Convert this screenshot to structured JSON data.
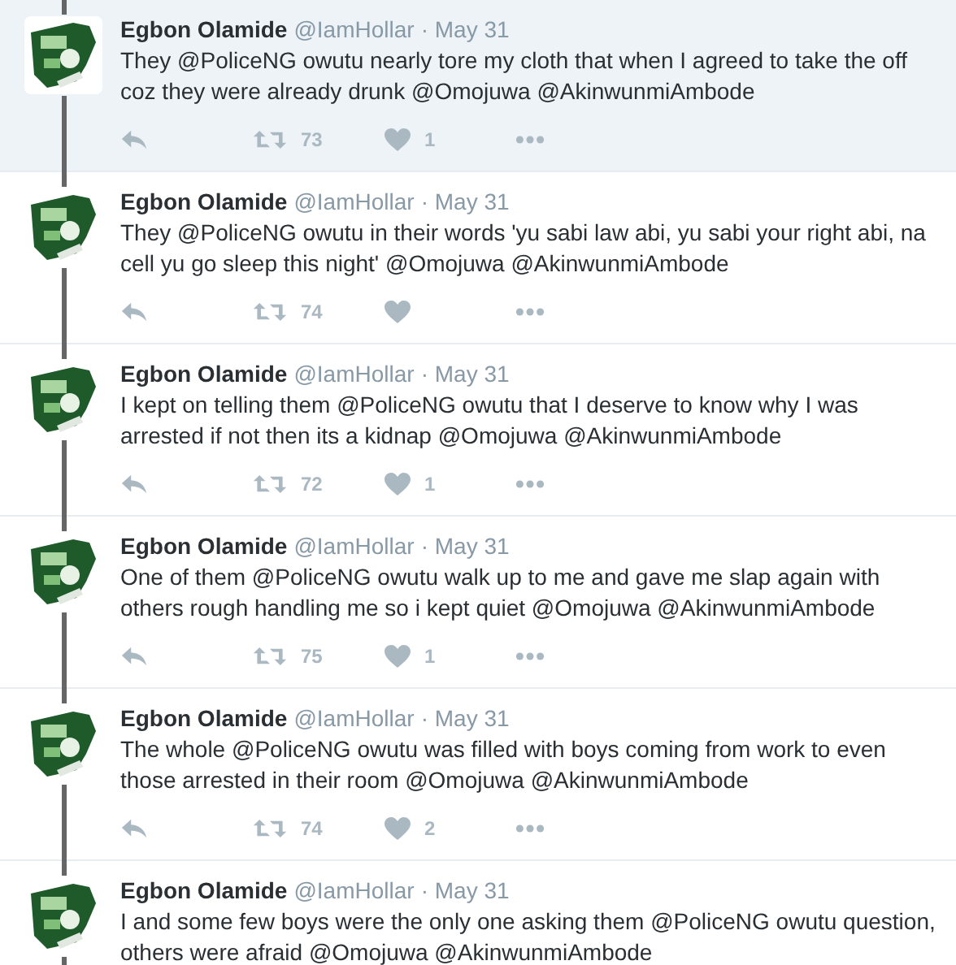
{
  "tweets": [
    {
      "name": "Egbon Olamide",
      "handle": "@IamHollar",
      "date": "· May 31",
      "text": "They @PoliceNG owutu nearly tore my cloth that when I agreed to take the off coz they were already drunk @Omojuwa @AkinwunmiAmbode",
      "retweets": "73",
      "likes": "1",
      "highlighted": true
    },
    {
      "name": "Egbon Olamide",
      "handle": "@IamHollar",
      "date": "· May 31",
      "text": "They @PoliceNG owutu in their words 'yu sabi law abi, yu sabi your right abi, na cell yu go sleep this night' @Omojuwa @AkinwunmiAmbode",
      "retweets": "74",
      "highlighted": false
    },
    {
      "name": "Egbon Olamide",
      "handle": "@IamHollar",
      "date": "· May 31",
      "text": "I kept on telling them @PoliceNG owutu that I deserve to know why I was arrested if not then its a kidnap @Omojuwa @AkinwunmiAmbode",
      "retweets": "72",
      "likes": "1",
      "highlighted": false
    },
    {
      "name": "Egbon Olamide",
      "handle": "@IamHollar",
      "date": "· May 31",
      "text": "One of them @PoliceNG owutu walk up to me and gave me slap again with others rough handling me so i kept quiet @Omojuwa @AkinwunmiAmbode",
      "retweets": "75",
      "likes": "1",
      "highlighted": false
    },
    {
      "name": "Egbon Olamide",
      "handle": "@IamHollar",
      "date": "· May 31",
      "text": "The whole @PoliceNG owutu was filled with boys coming from work to even those arrested in their room @Omojuwa @AkinwunmiAmbode",
      "retweets": "74",
      "likes": "2",
      "highlighted": false
    },
    {
      "name": "Egbon Olamide",
      "handle": "@IamHollar",
      "date": "· May 31",
      "text": "I and some few boys were the only one asking them @PoliceNG owutu question, others were afraid @Omojuwa @AkinwunmiAmbode",
      "highlighted": false
    }
  ]
}
